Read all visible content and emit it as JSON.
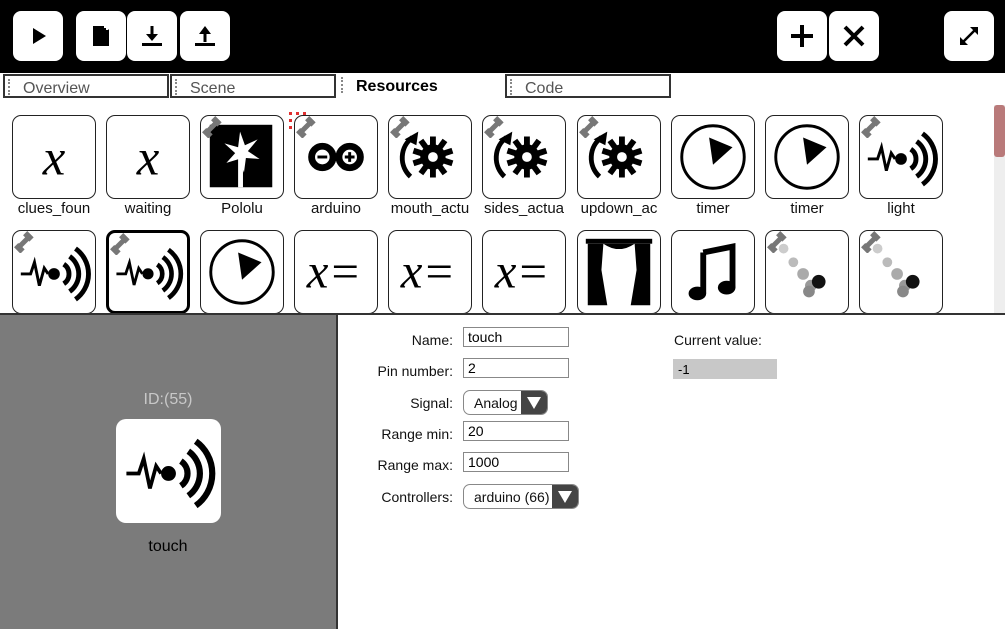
{
  "toolbar": {
    "left_buttons": [
      "play-icon",
      "new-file-icon",
      "download-icon",
      "upload-icon"
    ],
    "right_buttons": [
      "plus-icon",
      "close-icon"
    ],
    "expand": "expand-icon"
  },
  "tabs": [
    {
      "label": "Overview",
      "active": false
    },
    {
      "label": "Scene",
      "active": false
    },
    {
      "label": "Resources",
      "active": true
    },
    {
      "label": "Code",
      "active": false
    }
  ],
  "resources_row1": [
    {
      "label": "clues_foun",
      "icon": "variable-x-icon"
    },
    {
      "label": "waiting",
      "icon": "variable-x-icon"
    },
    {
      "label": "Pololu",
      "icon": "pololu-icon"
    },
    {
      "label": "arduino",
      "icon": "arduino-icon"
    },
    {
      "label": "mouth_actu",
      "icon": "gear-rotate-icon"
    },
    {
      "label": "sides_actua",
      "icon": "gear-rotate-icon"
    },
    {
      "label": "updown_ac",
      "icon": "gear-rotate-icon"
    },
    {
      "label": "timer",
      "icon": "clock-icon"
    },
    {
      "label": "timer",
      "icon": "clock-icon"
    },
    {
      "label": "light",
      "icon": "sensor-signal-icon"
    }
  ],
  "resources_row2": [
    {
      "icon": "sensor-signal-icon"
    },
    {
      "icon": "sensor-signal-icon",
      "selected": true
    },
    {
      "icon": "clock-icon"
    },
    {
      "icon": "assign-x-icon"
    },
    {
      "icon": "assign-x-icon"
    },
    {
      "icon": "assign-x-icon"
    },
    {
      "icon": "curtain-icon"
    },
    {
      "icon": "music-note-icon"
    },
    {
      "icon": "dots-animation-icon"
    },
    {
      "icon": "dots-animation-icon"
    }
  ],
  "detail": {
    "id_label": "ID:(55)",
    "name_display": "touch",
    "fields": {
      "name_label": "Name:",
      "name_value": "touch",
      "pin_label": "Pin number:",
      "pin_value": "2",
      "signal_label": "Signal:",
      "signal_value": "Analog",
      "range_min_label": "Range min:",
      "range_min_value": "20",
      "range_max_label": "Range max:",
      "range_max_value": "1000",
      "controllers_label": "Controllers:",
      "controllers_value": "arduino (66)"
    },
    "current_value_label": "Current value:",
    "current_value": "-1"
  },
  "colors": {
    "toolbar_bg": "#000000",
    "panel_bg": "#7b7b7b",
    "scroll_thumb": "#b97a7a"
  }
}
